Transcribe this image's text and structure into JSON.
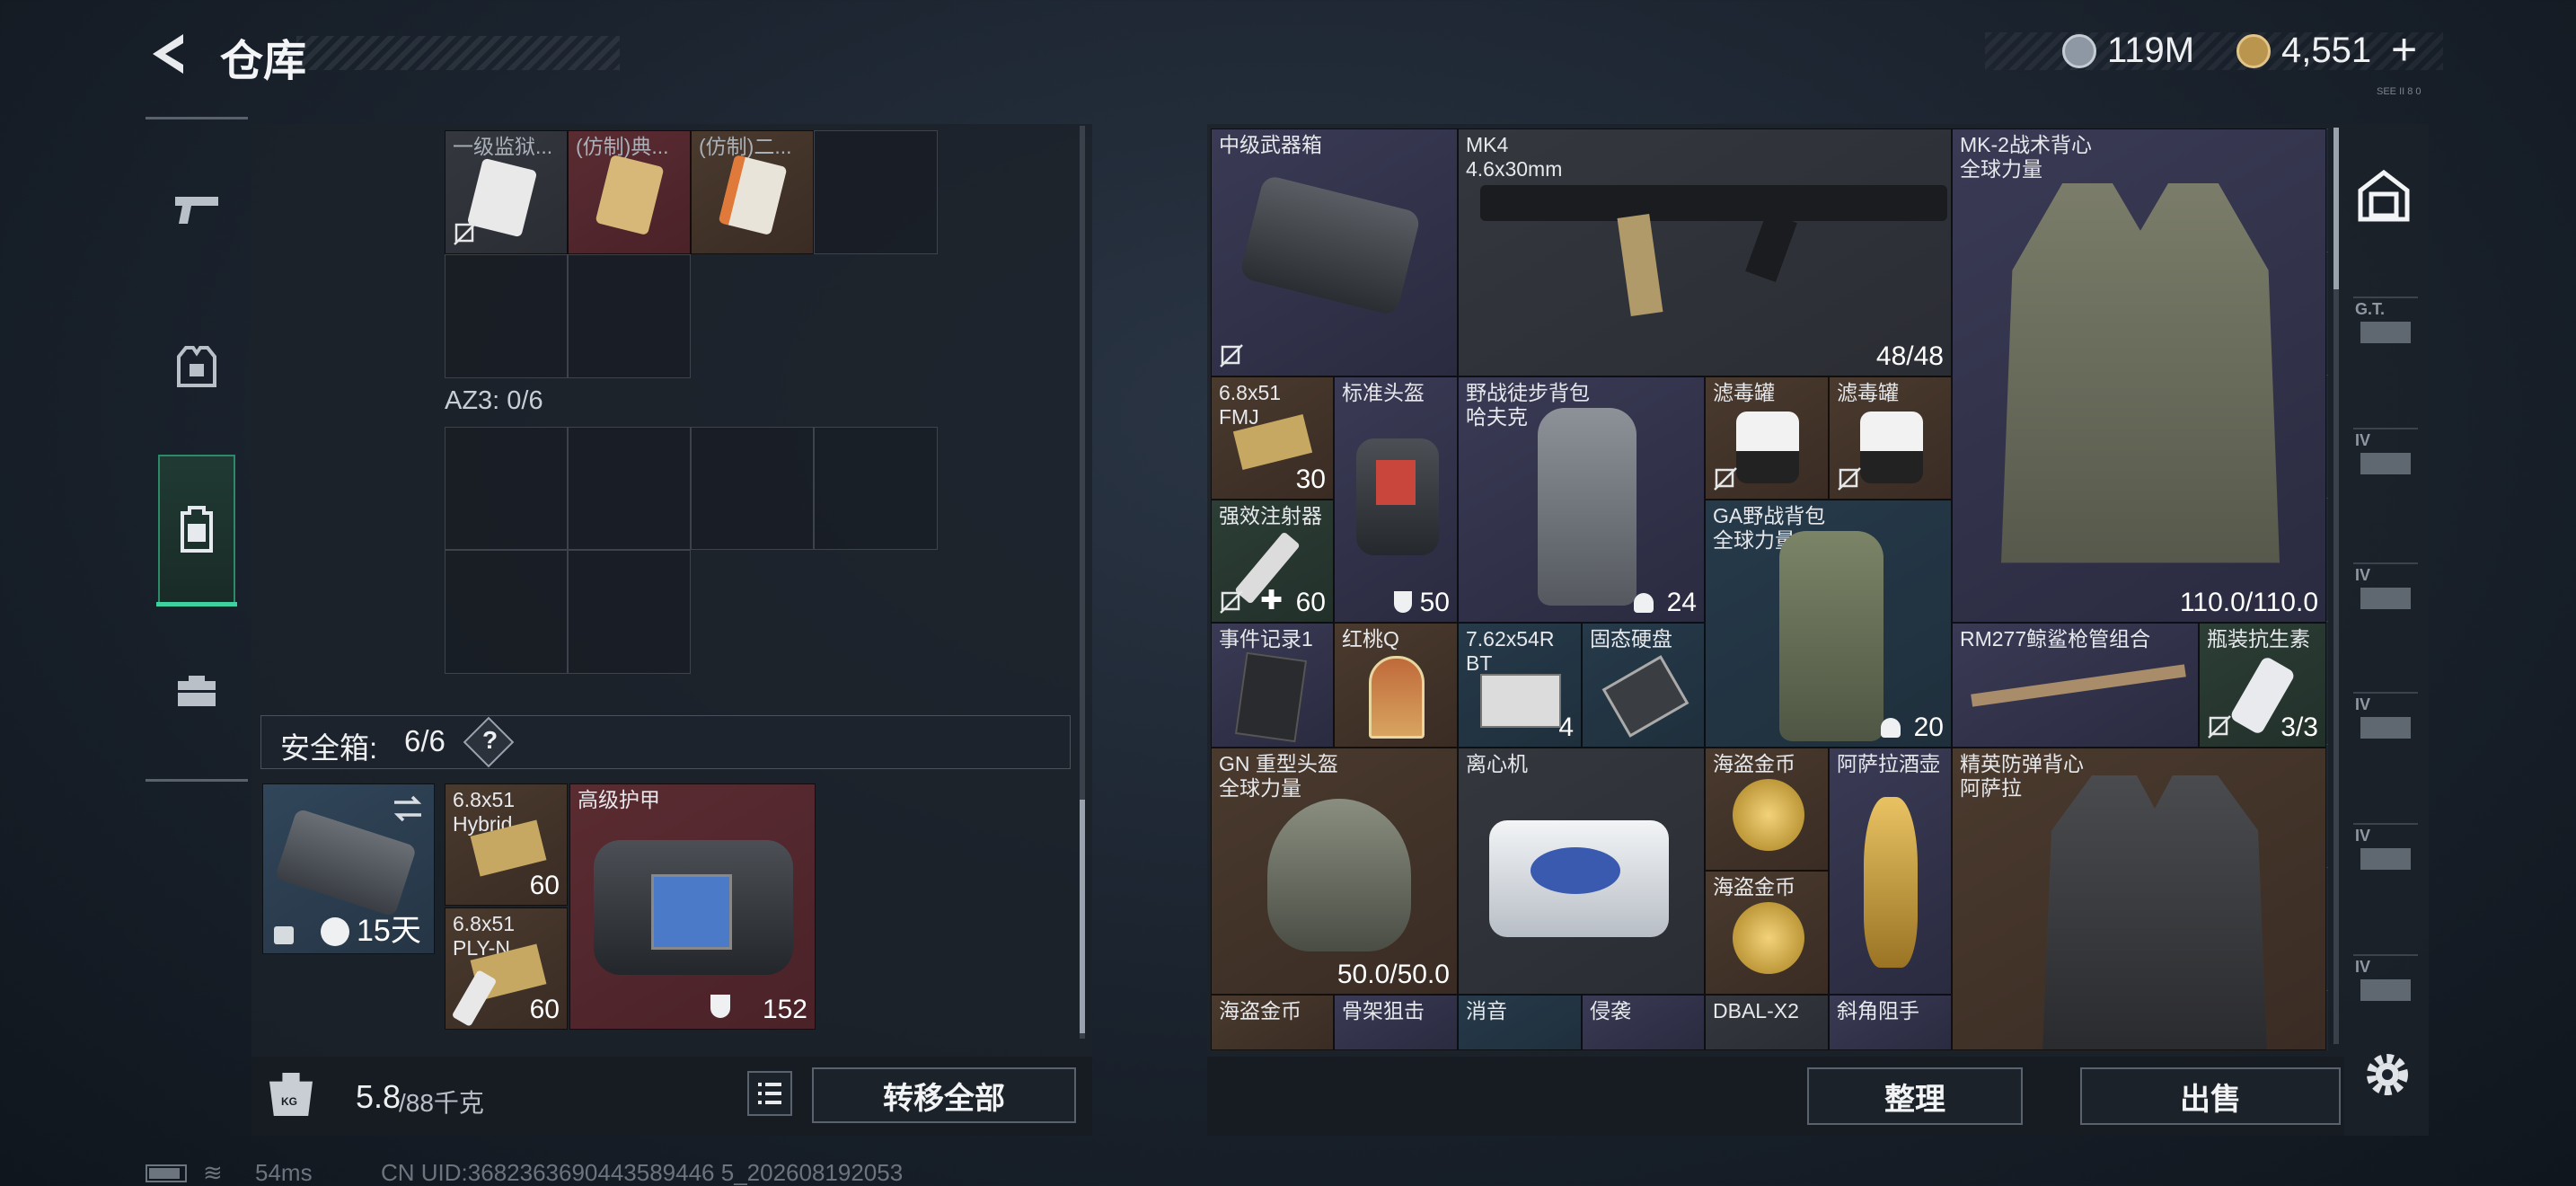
{
  "header": {
    "title": "仓库",
    "currency1": "119M",
    "currency2": "4,551",
    "plus": "+",
    "corner": "SEE II 8 0"
  },
  "left": {
    "az3": "AZ3: 0/6",
    "top_items": [
      {
        "name": "一级监狱..."
      },
      {
        "name": "(仿制)典..."
      },
      {
        "name": "(仿制)二..."
      }
    ],
    "safebox": {
      "label": "安全箱:",
      "count": "6/6",
      "help": "?",
      "timer": "15天"
    },
    "secure_items": [
      {
        "name": "6.8x51\nHybrid",
        "count": "60"
      },
      {
        "name": "6.8x51\nPLY-N",
        "count": "60"
      },
      {
        "name": "高级护甲",
        "count": "152"
      }
    ],
    "weight": {
      "value": "5.8",
      "max": "/88千克",
      "icon": "KG"
    },
    "transfer_label": "转移全部"
  },
  "right": {
    "items": [
      {
        "id": "a",
        "name": "中级武器箱",
        "count": ""
      },
      {
        "id": "b",
        "name": "MK4\n4.6x30mm",
        "count": "48/48"
      },
      {
        "id": "c",
        "name": "MK-2战术背心\n全球力量",
        "count": "110.0/110.0"
      },
      {
        "id": "d",
        "name": "6.8x51\nFMJ",
        "count": "30"
      },
      {
        "id": "e",
        "name": "标准头盔",
        "count": "50"
      },
      {
        "id": "f",
        "name": "野战徒步背包\n哈夫克",
        "count": "24"
      },
      {
        "id": "g",
        "name": "滤毒罐",
        "count": ""
      },
      {
        "id": "h",
        "name": "滤毒罐",
        "count": ""
      },
      {
        "id": "i",
        "name": "强效注射器",
        "count": "60"
      },
      {
        "id": "j",
        "name": "GA野战背包\n全球力量",
        "count": "20"
      },
      {
        "id": "k",
        "name": "事件记录1",
        "count": ""
      },
      {
        "id": "l",
        "name": "红桃Q",
        "count": ""
      },
      {
        "id": "m",
        "name": "7.62x54R\nBT",
        "count": "4"
      },
      {
        "id": "n",
        "name": "固态硬盘",
        "count": ""
      },
      {
        "id": "o",
        "name": "RM277鲸鲨枪管组合",
        "count": ""
      },
      {
        "id": "p",
        "name": "瓶装抗生素",
        "count": "3/3"
      },
      {
        "id": "q",
        "name": "GN 重型头盔\n全球力量",
        "count": "50.0/50.0"
      },
      {
        "id": "r",
        "name": "离心机",
        "count": ""
      },
      {
        "id": "s",
        "name": "海盗金币",
        "count": ""
      },
      {
        "id": "t",
        "name": "阿萨拉酒壶",
        "count": ""
      },
      {
        "id": "u",
        "name": "精英防弹背心\n阿萨拉",
        "count": ""
      },
      {
        "id": "v",
        "name": "海盗金币",
        "count": ""
      },
      {
        "id": "w",
        "name": "海盗金币",
        "count": ""
      },
      {
        "id": "x",
        "name": "骨架狙击",
        "count": ""
      },
      {
        "id": "y",
        "name": "消音",
        "count": ""
      },
      {
        "id": "z",
        "name": "侵袭",
        "count": ""
      },
      {
        "id": "aa",
        "name": "DBAL-X2",
        "count": ""
      },
      {
        "id": "ab",
        "name": "斜角阻手",
        "count": ""
      }
    ],
    "sort_label": "整理",
    "sell_label": "出售"
  },
  "side_tabs": [
    {
      "label": "G.T."
    },
    {
      "label": "IV"
    },
    {
      "label": "IV"
    },
    {
      "label": "IV"
    },
    {
      "label": "IV"
    },
    {
      "label": "IV"
    }
  ],
  "status": {
    "ping": "54ms",
    "uid": "CN UID:3682363690443589446 5_202608192053"
  },
  "colors": {
    "accent": "#3fd0a0",
    "panel": "#20262f",
    "icon_gold": "#c9a86a"
  }
}
